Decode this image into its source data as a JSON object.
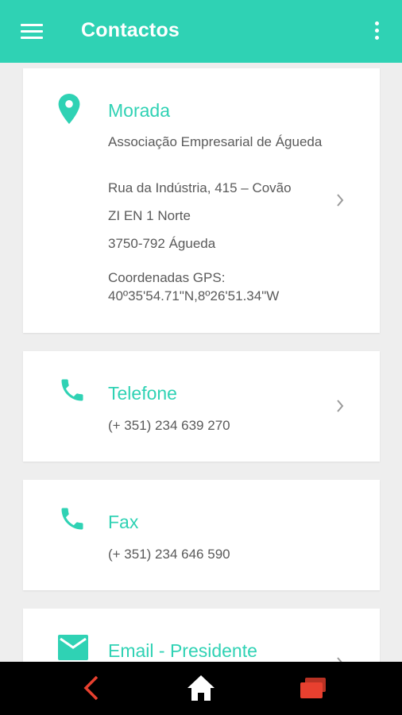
{
  "app_bar": {
    "title": "Contactos"
  },
  "cards": {
    "morada": {
      "icon": "location-pin-icon",
      "title": "Morada",
      "lines": [
        "Associação Empresarial de Águeda",
        "Rua da Indústria, 415 – Covão",
        "ZI EN 1 Norte",
        "3750-792 Águeda",
        "Coordenadas GPS: 40º35'54.71\"N,8º26'51.34\"W"
      ]
    },
    "telefone": {
      "icon": "phone-icon",
      "title": "Telefone",
      "value": "(+ 351) 234 639 270"
    },
    "fax": {
      "icon": "phone-icon",
      "title": "Fax",
      "value": "(+ 351) 234 646 590"
    },
    "email": {
      "icon": "email-icon",
      "title": "Email - Presidente"
    }
  },
  "colors": {
    "accent": "#2fd2b4",
    "background": "#eeeeee",
    "nav_bar": "#000000",
    "nav_icon_accent": "#e8402f"
  }
}
